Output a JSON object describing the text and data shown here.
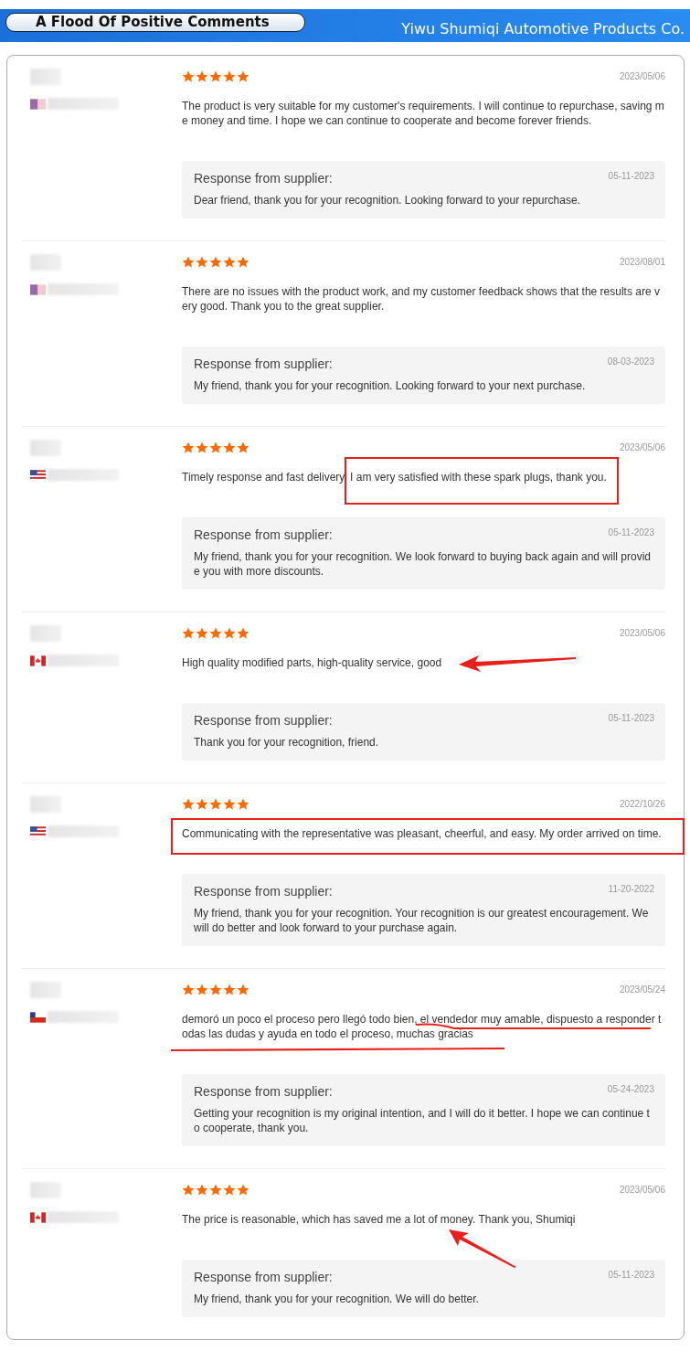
{
  "header": {
    "title": "A Flood Of Positive Comments",
    "company": "Yiwu Shumiqi Automotive Products Co."
  },
  "reviews": [
    {
      "flag": {
        "kind": "stripes"
      },
      "stars": 5,
      "date": "2023/05/06",
      "comment": "The product is very suitable for my customer's requirements. I will continue to repurchase, saving me money and time. I hope we can continue to cooperate and become forever friends.",
      "reply_title": "Response from supplier:",
      "reply_date": "05-11-2023",
      "reply": "Dear friend, thank you for your recognition. Looking forward to your repurchase."
    },
    {
      "flag": {
        "kind": "stripes"
      },
      "stars": 5,
      "date": "2023/08/01",
      "comment": "There are no issues with the product work, and my customer feedback shows that the results are very good. Thank you to the great supplier.",
      "reply_title": "Response from supplier:",
      "reply_date": "08-03-2023",
      "reply": "My friend, thank you for your recognition. Looking forward to your next purchase."
    },
    {
      "flag": {
        "kind": "us"
      },
      "stars": 5,
      "date": "2023/05/06",
      "comment": "Timely response and fast delivery. I am very satisfied with these spark plugs, thank you.",
      "annotation": {
        "kind": "box-right"
      },
      "reply_title": "Response from supplier:",
      "reply_date": "05-11-2023",
      "reply": "My friend, thank you for your recognition. We look forward to buying back again and will provide you with more discounts."
    },
    {
      "flag": {
        "kind": "ca"
      },
      "stars": 5,
      "date": "2023/05/06",
      "comment": "High quality modified parts, high-quality service, good",
      "annotation": {
        "kind": "arrow-left"
      },
      "reply_title": "Response from supplier:",
      "reply_date": "05-11-2023",
      "reply": "Thank you for your recognition, friend."
    },
    {
      "flag": {
        "kind": "us"
      },
      "stars": 5,
      "date": "2022/10/26",
      "comment": "Communicating with the representative was pleasant, cheerful, and easy. My order arrived on time.",
      "annotation": {
        "kind": "box-full"
      },
      "reply_title": "Response from supplier:",
      "reply_date": "11-20-2022",
      "reply": "My friend, thank you for your recognition. Your recognition is our greatest encouragement. We will do better and look forward to your purchase again."
    },
    {
      "flag": {
        "kind": "cl"
      },
      "stars": 5,
      "date": "2023/05/24",
      "comment": "demoró un poco el proceso pero llegó todo bien, el vendedor muy amable, dispuesto a responder todas las dudas y ayuda en todo el proceso, muchas gracias",
      "annotation": {
        "kind": "underline"
      },
      "reply_title": "Response from supplier:",
      "reply_date": "05-24-2023",
      "reply": "Getting your recognition is my original intention, and I will do it better. I hope we can continue to cooperate, thank you."
    },
    {
      "flag": {
        "kind": "ca"
      },
      "stars": 5,
      "date": "2023/05/06",
      "comment": "The price is reasonable, which has saved me a lot of money. Thank you, Shumiqi",
      "annotation": {
        "kind": "arrow-up"
      },
      "reply_title": "Response from supplier:",
      "reply_date": "05-11-2023",
      "reply": "My friend, thank you for your recognition. We will do better."
    }
  ]
}
